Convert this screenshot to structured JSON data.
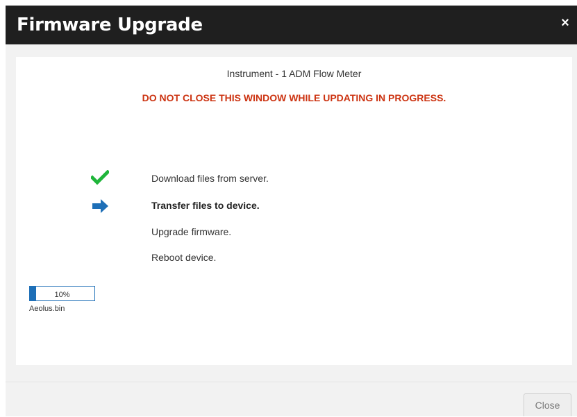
{
  "dialog": {
    "title": "Firmware Upgrade",
    "close_glyph": "×"
  },
  "body": {
    "instrument": "Instrument - 1 ADM Flow Meter",
    "warning": "DO NOT CLOSE THIS WINDOW WHILE UPDATING IN PROGRESS."
  },
  "steps": [
    {
      "label": "Download files from server.",
      "status": "done",
      "icon": "checkmark-icon"
    },
    {
      "label": "Transfer files to device.",
      "status": "active",
      "icon": "arrow-right-icon"
    },
    {
      "label": "Upgrade firmware.",
      "status": "pending",
      "icon": ""
    },
    {
      "label": "Reboot device.",
      "status": "pending",
      "icon": ""
    }
  ],
  "progress": {
    "percent_text": "10%",
    "value": 0.1,
    "file": "Aeolus.bin"
  },
  "footer": {
    "close_label": "Close"
  },
  "colors": {
    "header_bg": "#1f1f1f",
    "warning": "#cc3311",
    "check": "#1fb53a",
    "arrow": "#1e6fb7",
    "progress": "#1e6fb7"
  }
}
